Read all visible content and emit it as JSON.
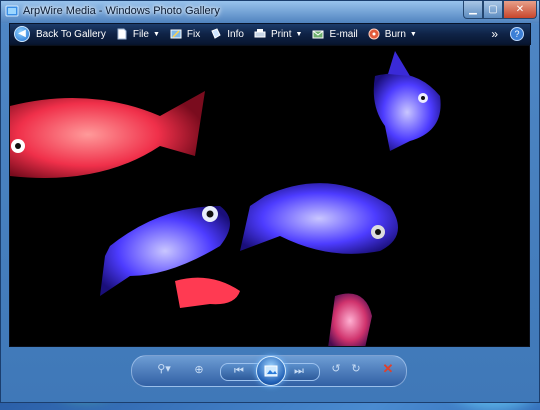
{
  "window": {
    "title": "ArpWire Media - Windows Photo Gallery"
  },
  "toolbar": {
    "back_label": "Back To Gallery",
    "file_label": "File",
    "fix_label": "Fix",
    "info_label": "Info",
    "print_label": "Print",
    "email_label": "E-mail",
    "burn_label": "Burn",
    "more_label": "»",
    "help_label": "?"
  },
  "viewer": {
    "subject": "glowing fish"
  },
  "colors": {
    "toolbar_bg": "#0f2346",
    "accent": "#3c7fd6",
    "delete": "#e0402a"
  },
  "icons": {
    "back": "back-arrow-icon",
    "file": "document-icon",
    "fix": "fix-icon",
    "info": "info-icon",
    "print": "printer-icon",
    "email": "email-icon",
    "burn": "disc-icon",
    "zoom": "magnifier-icon",
    "fit": "fit-window-icon",
    "prev": "previous-icon",
    "slideshow": "slideshow-icon",
    "next": "next-icon",
    "rotate_ccw": "rotate-ccw-icon",
    "rotate_cw": "rotate-cw-icon",
    "delete": "delete-icon"
  }
}
